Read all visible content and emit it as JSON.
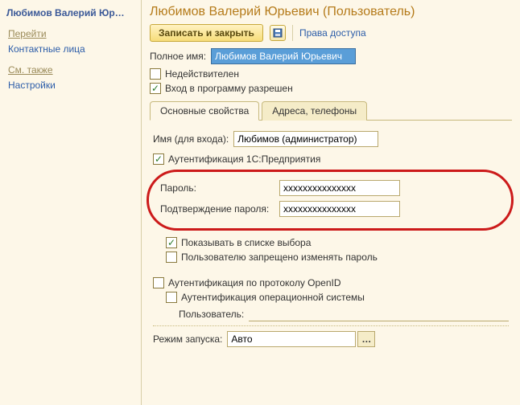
{
  "sidebar": {
    "title": "Любимов Валерий Юр…",
    "sections": [
      {
        "heading": "Перейти",
        "items": [
          "Контактные лица"
        ]
      },
      {
        "heading": "См. также",
        "items": [
          "Настройки"
        ]
      }
    ]
  },
  "page": {
    "title": "Любимов Валерий Юрьевич (Пользователь)"
  },
  "toolbar": {
    "save_label": "Записать и закрыть",
    "rights_label": "Права доступа"
  },
  "form": {
    "fullname_label": "Полное имя:",
    "fullname_value": "Любимов Валерий Юрьевич",
    "inactive_label": "Недействителен",
    "inactive_checked": false,
    "login_allowed_label": "Вход в программу разрешен",
    "login_allowed_checked": true
  },
  "tabs": {
    "main": "Основные свойства",
    "address": "Адреса, телефоны"
  },
  "main_tab": {
    "login_name_label": "Имя (для входа):",
    "login_name_value": "Любимов (администратор)",
    "auth_1c_label": "Аутентификация 1С:Предприятия",
    "auth_1c_checked": true,
    "password_label": "Пароль:",
    "password_value": "xxxxxxxxxxxxxxx",
    "confirm_label": "Подтверждение пароля:",
    "confirm_value": "xxxxxxxxxxxxxxx",
    "show_in_list_label": "Показывать в списке выбора",
    "show_in_list_checked": true,
    "cant_change_label": "Пользователю запрещено изменять пароль",
    "cant_change_checked": false,
    "auth_openid_label": "Аутентификация по протоколу OpenID",
    "auth_openid_checked": false,
    "auth_os_label": "Аутентификация операционной системы",
    "auth_os_checked": false,
    "os_user_label": "Пользователь:",
    "launch_label": "Режим запуска:",
    "launch_value": "Авто"
  }
}
